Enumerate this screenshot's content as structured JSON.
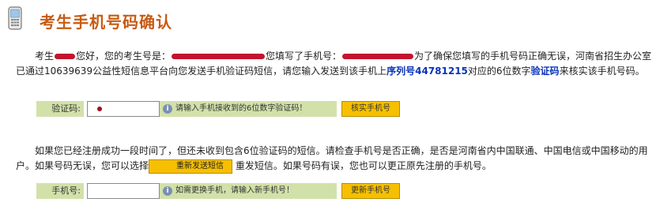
{
  "header": {
    "title": "考生手机号码确认"
  },
  "intro": {
    "t1": "考生",
    "t2": "您好，您的考生号是：",
    "t3": "您填写了手机号：",
    "t4": "为了确保您填写的手机号码正确无误，河南省招生办公室已通过10639639公益性短信息平台向您发送手机验证码短信，请您输入发送到该手机上",
    "serial": "序列号44781215",
    "t5": "对应的6位数字",
    "code_word": "验证码",
    "t6": "来核实该手机号码。"
  },
  "verify_row": {
    "label": "验证码:",
    "input_value": "",
    "hint": "请输入手机接收到的6位数字验证码！",
    "button": "核实手机号"
  },
  "resend": {
    "t1": "如果您已经注册成功一段时间了，但还未收到包含6位验证码的短信。请检查手机号是否正确，是否是河南省内中国联通、中国电信或中国移动的用户。如果号码无误，您可以选择",
    "button": "重新发送短信",
    "t2": "重发短信。如果号码有误，您也可以更正原先注册的手机号。"
  },
  "phone_row": {
    "label": "手机号:",
    "input_value": "",
    "hint": "如需更换手机，请输入新手机号！",
    "button": "更新手机号"
  },
  "colors": {
    "title": "#c75b12",
    "accent": "#0a33b8",
    "label_bg": "#d2e1aa",
    "button_bg": "#f6c000",
    "redaction": "#c3142e"
  }
}
